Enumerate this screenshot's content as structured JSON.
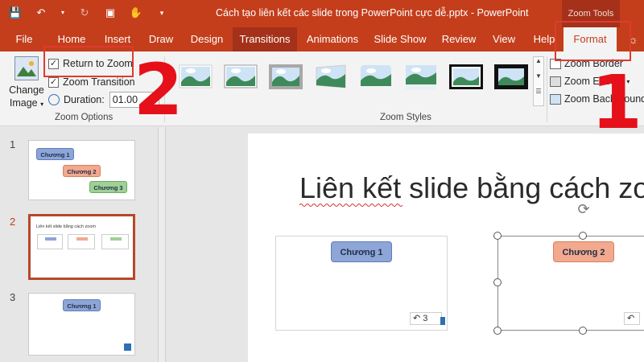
{
  "titlebar": {
    "document_title": "Cách tạo liên kết các slide trong PowerPoint cực dễ.pptx  -  PowerPoint",
    "context_tab_group": "Zoom Tools",
    "qat_icons": [
      "save-icon",
      "undo-icon",
      "undo-dropdown-icon",
      "redo-icon",
      "present-icon",
      "touch-mode-icon",
      "customize-qat-icon"
    ]
  },
  "tabs": [
    "File",
    "Home",
    "Insert",
    "Draw",
    "Design",
    "Transitions",
    "Animations",
    "Slide Show",
    "Review",
    "View",
    "Help",
    "Format"
  ],
  "ribbon": {
    "zoom_options": {
      "change_image_label_1": "Change",
      "change_image_label_2": "Image",
      "return_to_zoom": "Return to Zoom",
      "return_to_zoom_checked": true,
      "zoom_transition": "Zoom Transition",
      "zoom_transition_checked": true,
      "duration_label": "Duration:",
      "duration_value": "01.00",
      "group_label": "Zoom Options"
    },
    "zoom_styles": {
      "group_label": "Zoom Styles",
      "style_count": 8
    },
    "commands": {
      "zoom_border": "Zoom Border",
      "zoom_effects": "Zoom Effects",
      "zoom_background": "Zoom Background"
    }
  },
  "slides": [
    {
      "number": "1",
      "chips": [
        "Chương 1",
        "Chương 2",
        "Chương 3"
      ]
    },
    {
      "number": "2",
      "title": "Liên kết slide bằng cách zoom",
      "active": true
    },
    {
      "number": "3",
      "chips": [
        "Chương 1"
      ]
    }
  ],
  "editor": {
    "slide_title": "Liên kết slide bằng cách zoo",
    "zoom1_label": "Chương 1",
    "zoom1_badge": "3",
    "zoom2_label": "Chương 2"
  },
  "annotations": {
    "step1": "1",
    "step2": "2"
  },
  "colors": {
    "accent": "#c43e1c",
    "highlight_box": "#e03a2f",
    "chip_blue": "#8ea5d8",
    "chip_orange": "#f2a98e",
    "chip_green": "#9fd096"
  }
}
